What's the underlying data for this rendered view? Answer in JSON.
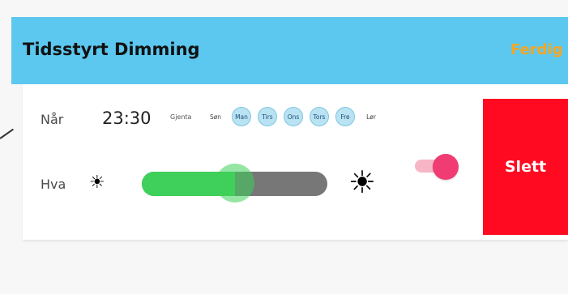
{
  "header": {
    "title": "Tidsstyrt Dimming",
    "done_label": "Ferdig",
    "background_color": "#5cc8ef",
    "done_color": "#f6a623"
  },
  "schedule": {
    "when_label": "Når",
    "time": "23:30",
    "repeat_label": "Gjenta",
    "days": [
      {
        "label": "Søn",
        "active": false
      },
      {
        "label": "Man",
        "active": true
      },
      {
        "label": "Tirs",
        "active": true
      },
      {
        "label": "Ons",
        "active": true
      },
      {
        "label": "Tors",
        "active": true
      },
      {
        "label": "Fre",
        "active": true
      },
      {
        "label": "Lør",
        "active": false
      }
    ],
    "what_label": "Hva",
    "brightness_fraction": 0.5,
    "min_icon": "sun-small-icon",
    "max_icon": "sun-large-icon",
    "toggle_on": true,
    "delete_label": "Slett",
    "delete_color": "#ff0a21",
    "slider_fill_color": "#3ed05a",
    "toggle_color": "#f03b73"
  }
}
